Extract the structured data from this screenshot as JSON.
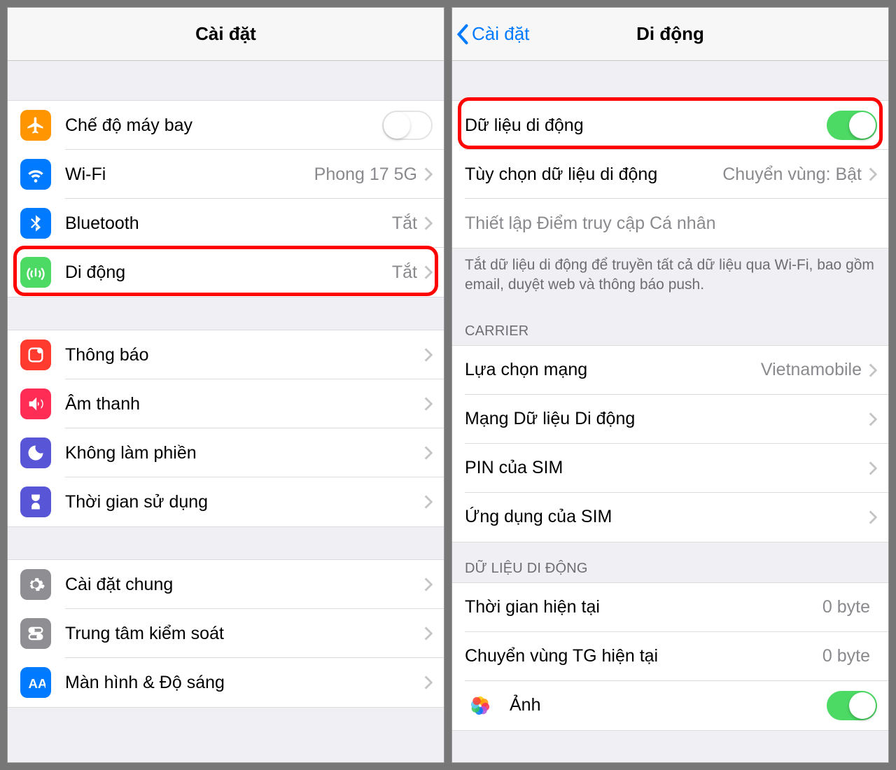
{
  "left": {
    "title": "Cài đặt",
    "group1": {
      "airplane": {
        "label": "Chế độ máy bay",
        "iconColor": "#ff9500"
      },
      "wifi": {
        "label": "Wi-Fi",
        "value": "Phong 17 5G",
        "iconColor": "#007aff"
      },
      "bluetooth": {
        "label": "Bluetooth",
        "value": "Tắt",
        "iconColor": "#007aff"
      },
      "cellular": {
        "label": "Di động",
        "value": "Tắt",
        "iconColor": "#4cd964"
      }
    },
    "group2": {
      "notifications": {
        "label": "Thông báo",
        "iconColor": "#ff3b30"
      },
      "sound": {
        "label": "Âm thanh",
        "iconColor": "#ff2d55"
      },
      "dnd": {
        "label": "Không làm phiền",
        "iconColor": "#5856d6"
      },
      "screentime": {
        "label": "Thời gian sử dụng",
        "iconColor": "#5856d6"
      }
    },
    "group3": {
      "general": {
        "label": "Cài đặt chung",
        "iconColor": "#8e8e93"
      },
      "control": {
        "label": "Trung tâm kiểm soát",
        "iconColor": "#8e8e93"
      },
      "display": {
        "label": "Màn hình & Độ sáng",
        "iconColor": "#007aff"
      }
    }
  },
  "right": {
    "back": "Cài đặt",
    "title": "Di động",
    "cellularData": {
      "label": "Dữ liệu di động",
      "on": true
    },
    "options": {
      "label": "Tùy chọn dữ liệu di động",
      "value": "Chuyển vùng: Bật"
    },
    "hotspot": {
      "label": "Thiết lập Điểm truy cập Cá nhân"
    },
    "footer1": "Tắt dữ liệu di động để truyền tất cả dữ liệu qua Wi-Fi, bao gồm email, duyệt web và thông báo push.",
    "carrierHeader": "CARRIER",
    "carrier": {
      "network": {
        "label": "Lựa chọn mạng",
        "value": "Vietnamobile"
      },
      "dataNet": {
        "label": "Mạng Dữ liệu Di động"
      },
      "simPin": {
        "label": "PIN của SIM"
      },
      "simApps": {
        "label": "Ứng dụng của SIM"
      }
    },
    "dataHeader": "DỮ LIỆU DI ĐỘNG",
    "usage": {
      "current": {
        "label": "Thời gian hiện tại",
        "value": "0 byte"
      },
      "roaming": {
        "label": "Chuyển vùng TG hiện tại",
        "value": "0 byte"
      }
    },
    "apps": {
      "photos": {
        "label": "Ảnh",
        "on": true
      }
    }
  }
}
